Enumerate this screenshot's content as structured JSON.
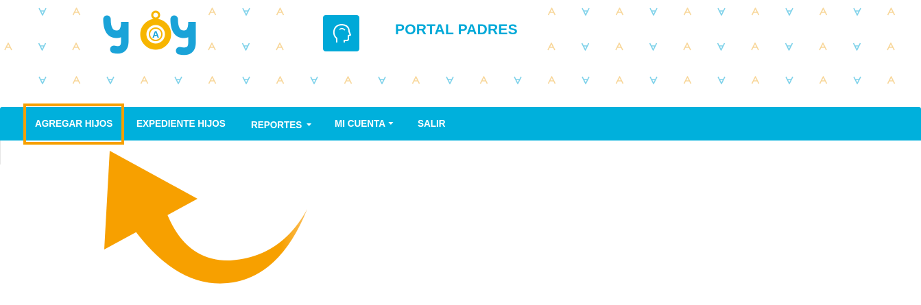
{
  "header": {
    "logo_icon": "yay-logo-icon",
    "portal_icon": "head-profile-icon",
    "title": "PORTAL PADRES"
  },
  "nav": {
    "items": [
      {
        "label": "AGREGAR HIJOS",
        "has_dropdown": false
      },
      {
        "label": "EXPEDIENTE HIJOS",
        "has_dropdown": false
      },
      {
        "label": "REPORTES",
        "has_dropdown": true
      },
      {
        "label": "MI CUENTA",
        "has_dropdown": true
      },
      {
        "label": "SALIR",
        "has_dropdown": false
      }
    ]
  },
  "annotation": {
    "highlighted_item": "AGREGAR HIJOS",
    "arrow_icon": "curved-arrow-icon"
  },
  "colors": {
    "brand_blue": "#00b0dc",
    "title_blue": "#00a9d8",
    "accent_orange": "#f7a000",
    "logo_yellow": "#f7b500",
    "pattern_blue": "#7fd2ea",
    "pattern_yellow": "#f8d79a"
  }
}
